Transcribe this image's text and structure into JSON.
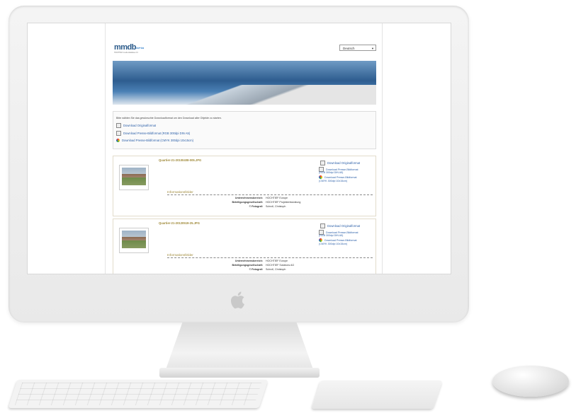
{
  "page": {
    "language": "Deutsch",
    "logo": "mmdb",
    "logo_sub": "HOCHTIEF media database 2.0"
  },
  "intro": {
    "text": "Bitte wählen Sie das gewünschte Downloadformat um den Download aller Objekte zu starten.",
    "links": [
      "Download Originalformat",
      "Download Presse-Bildformat (RGB 300dpi DIN A5)",
      "Download Presse-Bildformat (CMYK 300dpi 10x15cm)"
    ]
  },
  "items": [
    {
      "filename": "Quartier-21-20100408-005.JPG",
      "downloads": [
        "Download Originalformat",
        "Download Presse-Bildformat",
        "(RGB 300dpi DIN A5)",
        "Download Presse-Bildformat",
        "(CMYK 300dpi 10x15cm)"
      ],
      "fields_title": "Informationsfelder",
      "fields": [
        {
          "k": "Unternehmensbereich:",
          "v": "HOCHTIEF Europe"
        },
        {
          "k": "Beteiligungsgesellschaft:",
          "v": "HOCHTIEF Projektentwicklung"
        },
        {
          "k": "© Fotograf:",
          "v": "Schroll, Christoph"
        }
      ]
    },
    {
      "filename": "Quartier-21-20120519-25.JPG",
      "downloads": [
        "Download Originalformat",
        "Download Presse-Bildformat",
        "(RGB 300dpi DIN A5)",
        "Download Presse-Bildformat",
        "(CMYK 300dpi 10x15cm)"
      ],
      "fields_title": "Informationsfelder",
      "fields": [
        {
          "k": "Unternehmensbereich:",
          "v": "HOCHTIEF Europe"
        },
        {
          "k": "Beteiligungsgesellschaft:",
          "v": "HOCHTIEF Solutions AG"
        },
        {
          "k": "© Fotograf:",
          "v": "Schroll, Christoph"
        }
      ]
    }
  ]
}
